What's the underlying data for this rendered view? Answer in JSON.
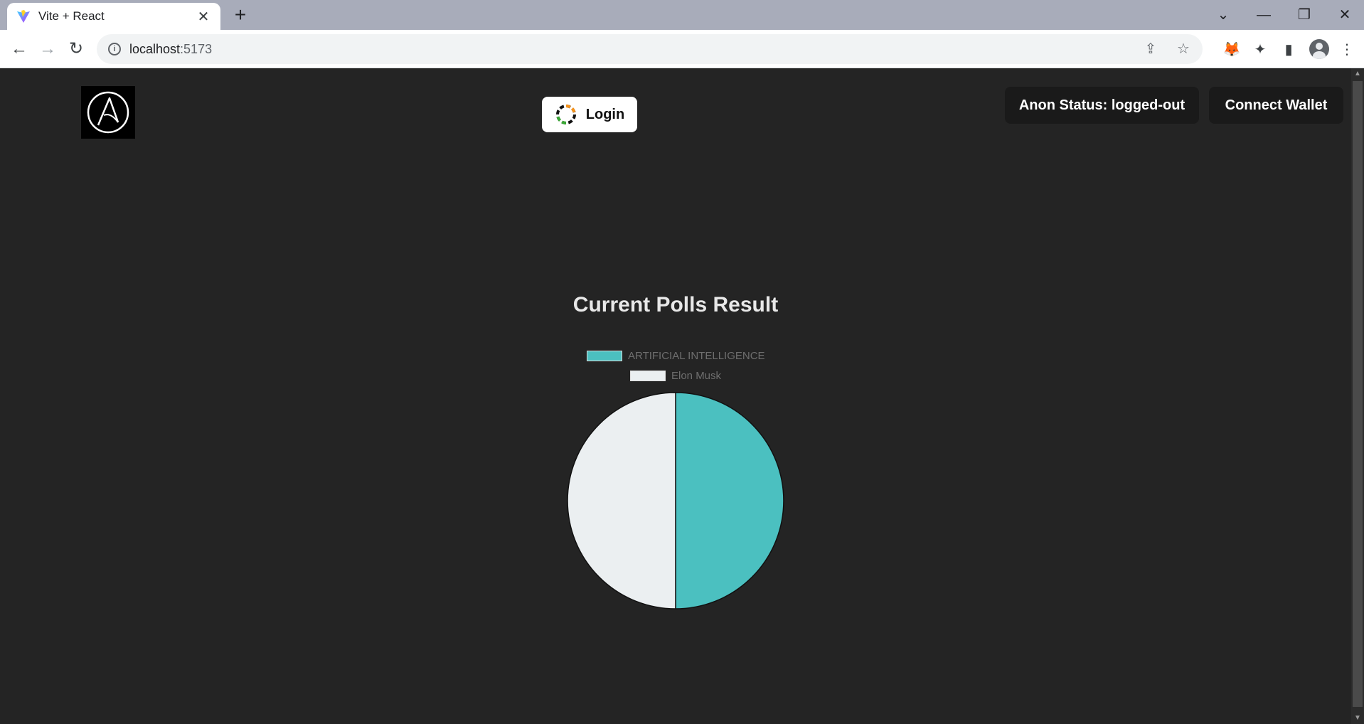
{
  "browser": {
    "tab_title": "Vite + React",
    "url_host": "localhost",
    "url_port": ":5173"
  },
  "header": {
    "login_label": "Login",
    "status_label": "Anon Status: logged-out",
    "wallet_label": "Connect Wallet"
  },
  "poll": {
    "title": "Current Polls Result"
  },
  "chart_data": {
    "type": "pie",
    "title": "Current Polls Result",
    "categories": [
      "ARTIFICIAL INTELLIGENCE",
      "Elon Musk"
    ],
    "values": [
      1,
      1
    ],
    "colors": [
      "#4bc0c0",
      "#ebeff1"
    ],
    "legend_position": "top"
  }
}
